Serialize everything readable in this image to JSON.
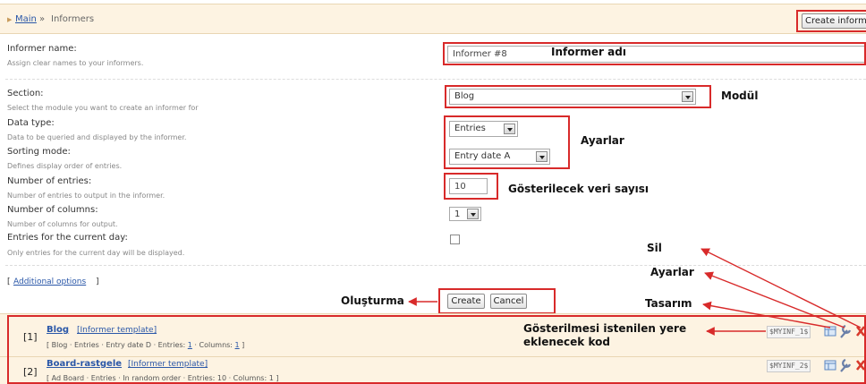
{
  "breadcrumb": {
    "main": "Main",
    "separator": "»",
    "current": "Informers"
  },
  "header": {
    "create_button": "Create informer"
  },
  "form": {
    "informer_name": {
      "label": "Informer name:",
      "hint": "Assign clear names to your informers.",
      "value": "Informer #8"
    },
    "section": {
      "label": "Section:",
      "hint": "Select the module you want to create an informer for",
      "value": "Blog"
    },
    "data_type": {
      "label": "Data type:",
      "hint": "Data to be queried and displayed by the informer.",
      "value": "Entries"
    },
    "sorting_mode": {
      "label": "Sorting mode:",
      "hint": "Defines display order of entries.",
      "value": "Entry date A"
    },
    "number_of_entries": {
      "label": "Number of entries:",
      "hint": "Number of entries to output in the informer.",
      "value": "10"
    },
    "number_of_columns": {
      "label": "Number of columns:",
      "hint": "Number of columns for output.",
      "value": "1"
    },
    "current_day": {
      "label": "Entries for the current day:",
      "hint": "Only entries for the current day will be displayed.",
      "checked": false
    },
    "additional_options": {
      "open": "[",
      "link": "Additional options",
      "close": "]"
    },
    "create_button": "Create",
    "cancel_button": "Cancel"
  },
  "annotations": {
    "informer_adi": "Informer adı",
    "modul": "Modül",
    "ayarlar_form": "Ayarlar",
    "gosterilecek": "Gösterilecek veri sayısı",
    "olusturma": "Oluşturma",
    "sil": "Sil",
    "ayarlar_icon": "Ayarlar",
    "tasarim": "Tasarım",
    "kod_line1": "Gösterilmesi istenilen yere",
    "kod_line2": "eklenecek kod"
  },
  "informers": [
    {
      "index": "[1]",
      "title": "Blog",
      "template_link": "[Informer template]",
      "meta_prefix": "[ Blog · Entries · Entry date D · Entries: ",
      "entries": "1",
      "meta_mid": " · Columns: ",
      "columns": "1",
      "meta_suffix": " ]",
      "code": "$MYINF_1$"
    },
    {
      "index": "[2]",
      "title": "Board-rastgele",
      "template_link": "[Informer template]",
      "meta_prefix": "[ Ad Board · Entries · In random order · Entries: 10 · Columns: 1 ]",
      "code": "$MYINF_2$"
    }
  ],
  "colors": {
    "accent_red": "#d82a2a",
    "link_blue": "#2a57a8",
    "header_bg": "#fdf3e2"
  },
  "icons": [
    "design-icon",
    "settings-wrench-icon",
    "delete-icon"
  ]
}
